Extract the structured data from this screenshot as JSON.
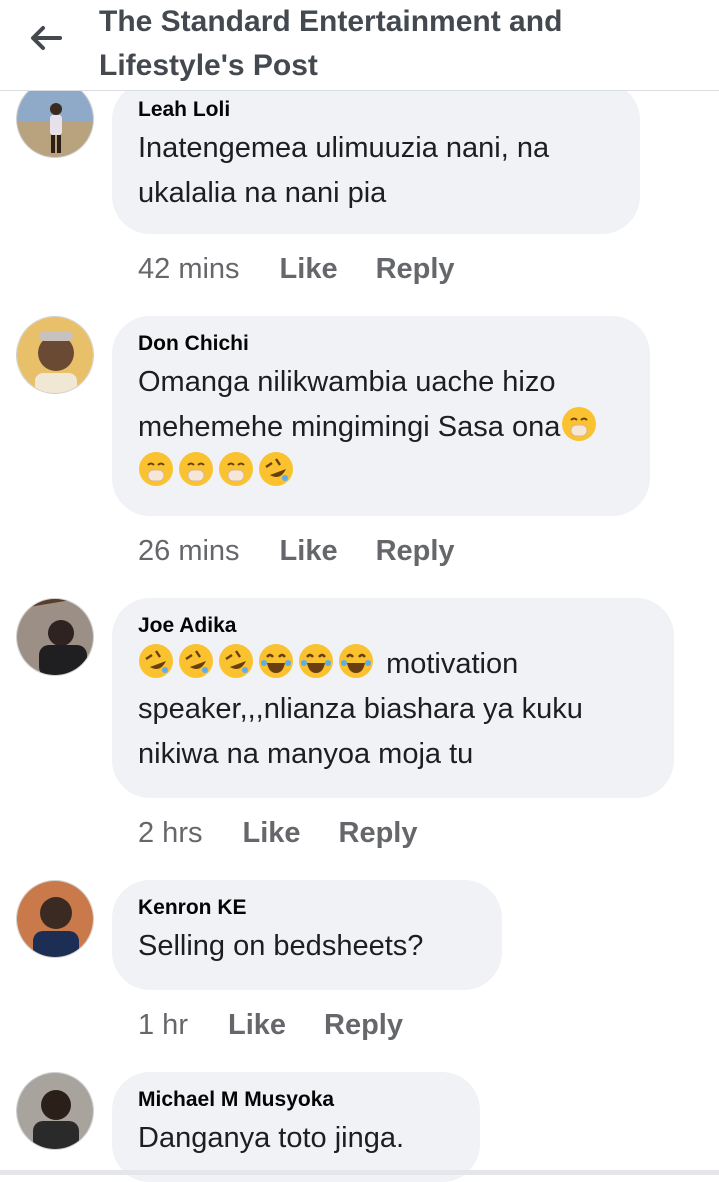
{
  "header": {
    "title": "The Standard Entertainment and Lifestyle's Post",
    "back_icon": "arrow-left-icon"
  },
  "comments": [
    {
      "author": "Leah Loli",
      "text": "Inatengemea ulimuuzia nani, na ukalalia na nani pia",
      "time": "42 mins",
      "like": "Like",
      "reply": "Reply"
    },
    {
      "author": "Don Chichi",
      "text": "Omanga nilikwambia uache hizo mehemehe mingimingi Sasa ona",
      "emojis": [
        "face-with-hand-over-mouth",
        "face-with-hand-over-mouth",
        "face-with-hand-over-mouth",
        "face-with-hand-over-mouth",
        "rolling-on-floor-laughing"
      ],
      "time": "26 mins",
      "like": "Like",
      "reply": "Reply"
    },
    {
      "author": "Joe Adika",
      "emojis": [
        "rolling-on-floor-laughing",
        "rolling-on-floor-laughing",
        "rolling-on-floor-laughing",
        "face-with-tears-of-joy",
        "face-with-tears-of-joy",
        "face-with-tears-of-joy"
      ],
      "text": "motivation speaker,,,nlianza biashara ya kuku nikiwa na manyoa moja tu",
      "time": "2 hrs",
      "like": "Like",
      "reply": "Reply"
    },
    {
      "author": "Kenron KE",
      "text": "Selling on bedsheets?",
      "time": "1 hr",
      "like": "Like",
      "reply": "Reply"
    },
    {
      "author": "Michael M Musyoka",
      "text": "Danganya toto jinga."
    }
  ],
  "colors": {
    "bubble": "#f0f2f5",
    "meta": "#65676b",
    "title": "#444950",
    "emoji_face": "#f9c22e"
  }
}
